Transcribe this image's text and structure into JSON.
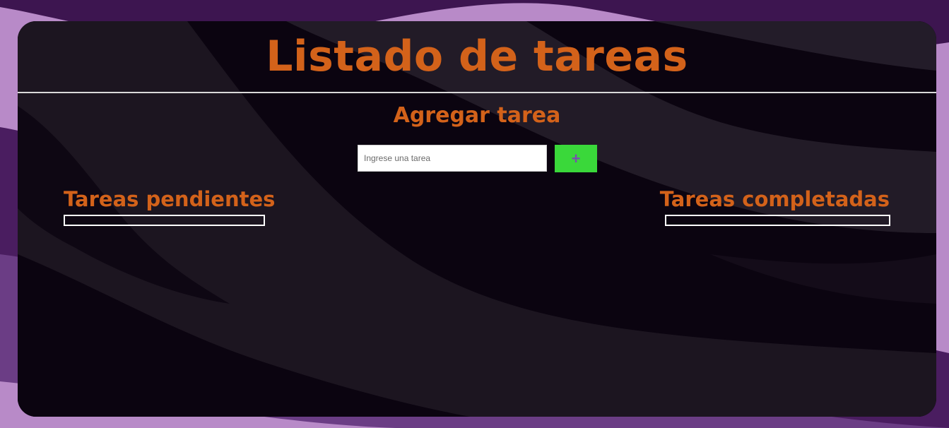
{
  "page": {
    "title": "Listado de tareas"
  },
  "add_section": {
    "heading": "Agregar tarea",
    "input_placeholder": "Ingrese una tarea",
    "input_value": "",
    "add_button_label": "+"
  },
  "pending": {
    "heading": "Tareas pendientes",
    "items": []
  },
  "completed": {
    "heading": "Tareas completadas",
    "items": []
  },
  "colors": {
    "accent": "#d3621a",
    "add_button": "#3ad83a",
    "add_button_icon": "#7a4fb0",
    "panel": "#120b16",
    "outer_background": "#b88ac8"
  }
}
